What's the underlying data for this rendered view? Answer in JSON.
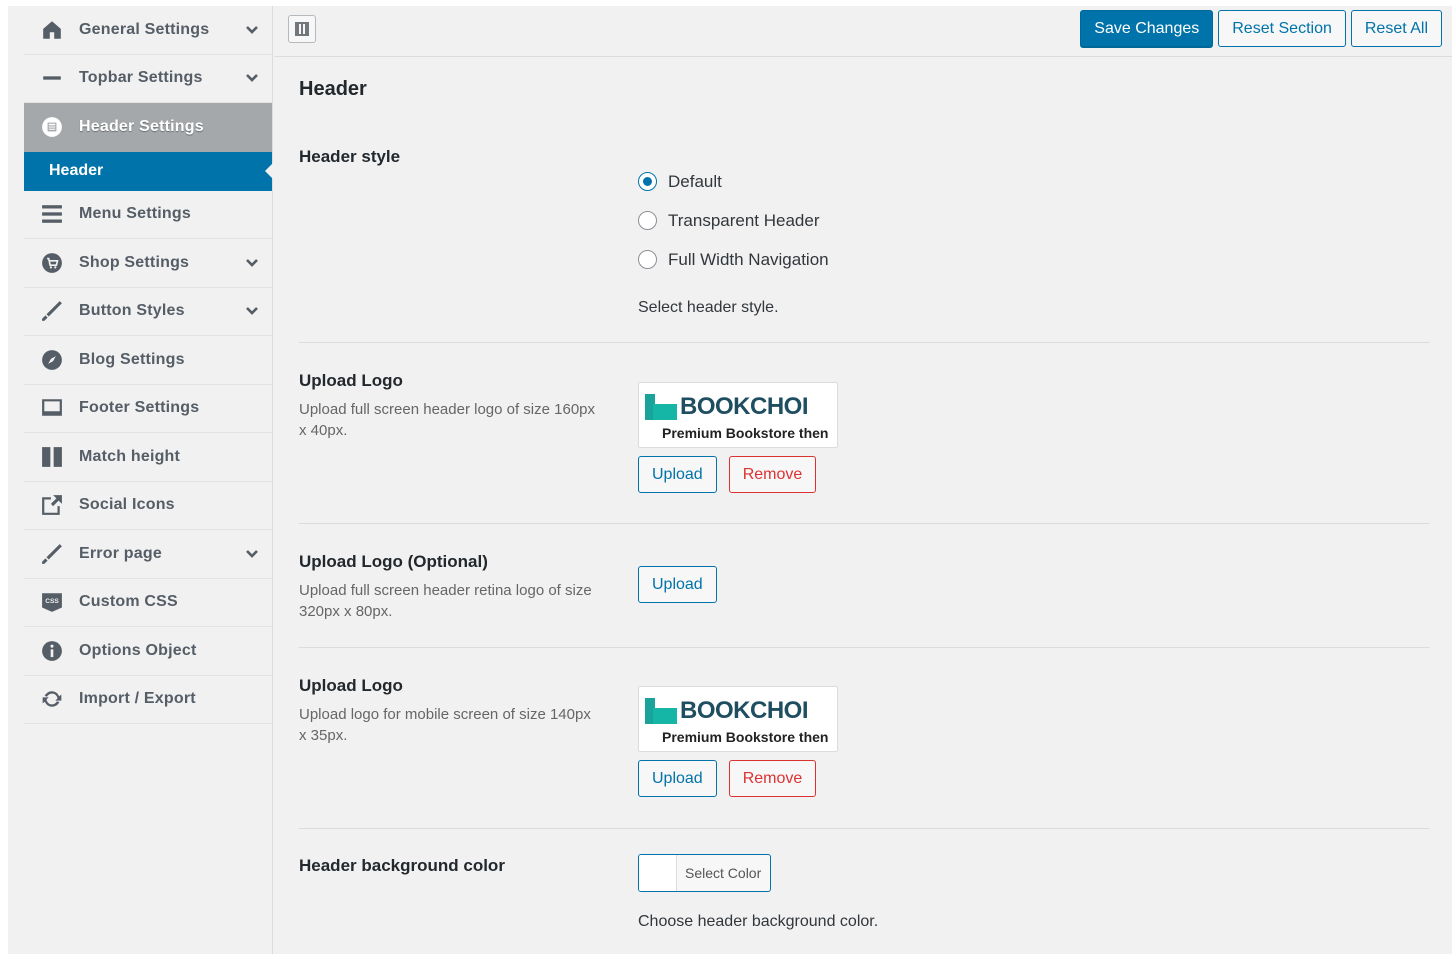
{
  "sidebar": {
    "items": [
      {
        "label": "General Settings",
        "icon": "home-icon",
        "has_children": true
      },
      {
        "label": "Topbar Settings",
        "icon": "minus-icon",
        "has_children": true
      },
      {
        "label": "Header Settings",
        "icon": "header-icon",
        "has_children": false,
        "active": true
      },
      {
        "label": "Menu Settings",
        "icon": "menu-icon",
        "has_children": false
      },
      {
        "label": "Shop Settings",
        "icon": "cart-icon",
        "has_children": true
      },
      {
        "label": "Button Styles",
        "icon": "brush-icon",
        "has_children": true
      },
      {
        "label": "Blog Settings",
        "icon": "compass-icon",
        "has_children": false
      },
      {
        "label": "Footer Settings",
        "icon": "footer-icon",
        "has_children": false
      },
      {
        "label": "Match height",
        "icon": "columns-icon",
        "has_children": false
      },
      {
        "label": "Social Icons",
        "icon": "share-icon",
        "has_children": false
      },
      {
        "label": "Error page",
        "icon": "brush-icon",
        "has_children": true
      },
      {
        "label": "Custom CSS",
        "icon": "css-icon",
        "has_children": false
      },
      {
        "label": "Options Object",
        "icon": "info-icon",
        "has_children": false
      },
      {
        "label": "Import / Export",
        "icon": "refresh-icon",
        "has_children": false
      }
    ],
    "active_sub": "Header"
  },
  "toolbar": {
    "save_label": "Save Changes",
    "reset_section_label": "Reset Section",
    "reset_all_label": "Reset All"
  },
  "main": {
    "page_title": "Header",
    "header_style": {
      "title": "Header style",
      "options": [
        "Default",
        "Transparent Header",
        "Full Width Navigation"
      ],
      "selected": "Default",
      "help": "Select header style."
    },
    "upload_logo": {
      "title": "Upload Logo",
      "desc": "Upload full screen header logo of size 160px x 40px.",
      "logo_word": "BOOKCHOI",
      "logo_tagline": "Premium Bookstore then",
      "upload_label": "Upload",
      "remove_label": "Remove"
    },
    "upload_logo_optional": {
      "title": "Upload Logo (Optional)",
      "desc": "Upload full screen header retina logo of size 320px x 80px.",
      "upload_label": "Upload"
    },
    "upload_logo_mobile": {
      "title": "Upload Logo",
      "desc": "Upload logo for mobile screen of size 140px x 35px.",
      "logo_word": "BOOKCHOI",
      "logo_tagline": "Premium Bookstore then",
      "upload_label": "Upload",
      "remove_label": "Remove"
    },
    "header_bg": {
      "title": "Header background color",
      "select_label": "Select Color",
      "help": "Choose header background color.",
      "current_color": "#ffffff"
    }
  },
  "colors": {
    "accent": "#0073aa",
    "danger": "#dc3232",
    "sidebar_active": "#a4a8ab"
  }
}
